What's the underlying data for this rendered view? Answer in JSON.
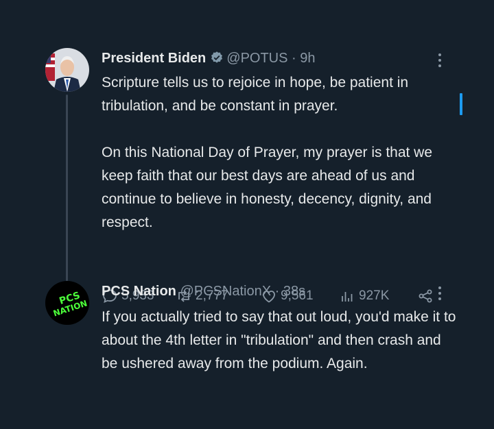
{
  "tweets": [
    {
      "name": "President Biden",
      "handle": "@POTUS",
      "sep": "·",
      "time": "9h",
      "text": "Scripture tells us to rejoice in hope, be patient in tribulation, and be constant in prayer.\n\nOn this National Day of Prayer, my prayer is that we keep faith that our best days are ahead of us and continue to believe in honesty, decency, dignity, and respect.",
      "replies": "5,933",
      "reposts": "2,777",
      "likes": "9,561",
      "views": "927K"
    },
    {
      "name": "PCS Nation",
      "handle": "@PCSNationX",
      "sep": "·",
      "time": "38s",
      "text": "If you actually tried to say that out loud, you'd make it to about the 4th letter in \"tribulation\" and then crash and be ushered away from the podium. Again.",
      "avatar_text_top": "PCS",
      "avatar_text_bottom": "NATION"
    }
  ],
  "colors": {
    "background": "#15202b",
    "text": "#e7e9ea",
    "muted": "#8b98a5",
    "accent": "#1d9bf0",
    "verified": "#829aab",
    "logo_green": "#4cff3a"
  },
  "icons": [
    "verified-badge-icon",
    "more-icon",
    "reply-icon",
    "repost-icon",
    "like-icon",
    "views-icon",
    "share-icon"
  ]
}
